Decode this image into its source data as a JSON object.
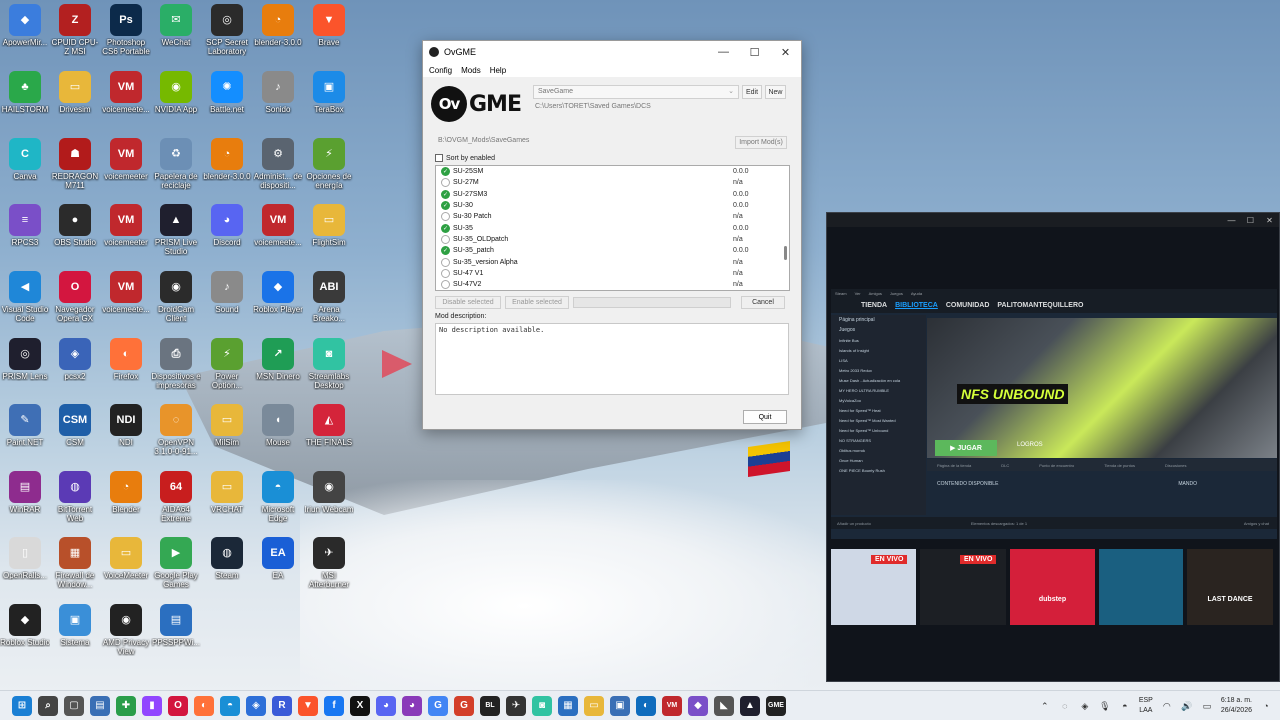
{
  "desktop": {
    "icons": [
      {
        "label": "ApowerMir...",
        "glyph": "◆",
        "color": "#3b7ddd"
      },
      {
        "label": "CPUID CPU-Z MSI",
        "glyph": "Z",
        "color": "#b32020"
      },
      {
        "label": "Photoshop CS6 Portable",
        "glyph": "Ps",
        "color": "#0c2a4a"
      },
      {
        "label": "WeChat",
        "glyph": "✉",
        "color": "#2aae67"
      },
      {
        "label": "SCP Secret Laboratory",
        "glyph": "◎",
        "color": "#2b2b2b"
      },
      {
        "label": "blender-3.0.0",
        "glyph": "◔",
        "color": "#e87d0d"
      },
      {
        "label": "Brave",
        "glyph": "▼",
        "color": "#fb542b"
      },
      {
        "label": "HAILSTORM",
        "glyph": "♣",
        "color": "#2aa84a"
      },
      {
        "label": "Drivesim",
        "glyph": "▭",
        "color": "#e8b73a"
      },
      {
        "label": "voicemeete...",
        "glyph": "VM",
        "color": "#c0282d"
      },
      {
        "label": "NVIDIA App",
        "glyph": "◉",
        "color": "#76b900"
      },
      {
        "label": "Battle.net",
        "glyph": "✺",
        "color": "#148eff"
      },
      {
        "label": "Sonido",
        "glyph": "♪",
        "color": "#8a8a8a"
      },
      {
        "label": "TeraBox",
        "glyph": "▣",
        "color": "#1c8be8"
      },
      {
        "label": "Canva",
        "glyph": "C",
        "color": "#1fb6c6"
      },
      {
        "label": "REDRAGON M711",
        "glyph": "☗",
        "color": "#b21b1b"
      },
      {
        "label": "voicemeeter",
        "glyph": "VM",
        "color": "#c0282d"
      },
      {
        "label": "Papelera de reciclaje",
        "glyph": "♻",
        "color": "#6c8fb5"
      },
      {
        "label": "blender-3.0.0",
        "glyph": "◔",
        "color": "#e87d0d"
      },
      {
        "label": "Administ... de dispositi...",
        "glyph": "⚙",
        "color": "#5a6470"
      },
      {
        "label": "Opciones de energía",
        "glyph": "⚡",
        "color": "#5aa030"
      },
      {
        "label": "RPCS3",
        "glyph": "≡",
        "color": "#7a4fc8"
      },
      {
        "label": "OBS Studio",
        "glyph": "●",
        "color": "#2b2b2b"
      },
      {
        "label": "voicemeeter",
        "glyph": "VM",
        "color": "#c0282d"
      },
      {
        "label": "PRISM Live Studio",
        "glyph": "▲",
        "color": "#1f1f2e"
      },
      {
        "label": "Discord",
        "glyph": "◕",
        "color": "#5865f2"
      },
      {
        "label": "voicemeete...",
        "glyph": "VM",
        "color": "#c0282d"
      },
      {
        "label": "FlightSim",
        "glyph": "▭",
        "color": "#e8b73a"
      },
      {
        "label": "Visual Studio Code",
        "glyph": "◀",
        "color": "#1f87d8"
      },
      {
        "label": "Navegador Opera GX",
        "glyph": "O",
        "color": "#d3163f"
      },
      {
        "label": "voicemeete...",
        "glyph": "VM",
        "color": "#c0282d"
      },
      {
        "label": "DroidCam Client",
        "glyph": "◉",
        "color": "#2b2b2b"
      },
      {
        "label": "Sound",
        "glyph": "♪",
        "color": "#8a8a8a"
      },
      {
        "label": "Roblox Player",
        "glyph": "◆",
        "color": "#1a73e8"
      },
      {
        "label": "Arena Breako...",
        "glyph": "ABI",
        "color": "#3a3a3a"
      },
      {
        "label": "PRISM Lens",
        "glyph": "◎",
        "color": "#1f1f2e"
      },
      {
        "label": "pcsx2",
        "glyph": "◈",
        "color": "#3a64b8"
      },
      {
        "label": "Firefox",
        "glyph": "◐",
        "color": "#ff7139"
      },
      {
        "label": "Dispositivos e impresoras",
        "glyph": "⎙",
        "color": "#6a7480"
      },
      {
        "label": "Power Option...",
        "glyph": "⚡",
        "color": "#5aa030"
      },
      {
        "label": "MSN Dinero",
        "glyph": "↗",
        "color": "#1f9d55"
      },
      {
        "label": "Streamlabs Desktop",
        "glyph": "◙",
        "color": "#31c3a2"
      },
      {
        "label": "Paint.NET",
        "glyph": "✎",
        "color": "#3f6fb5"
      },
      {
        "label": "CSM",
        "glyph": "CSM",
        "color": "#1f5fa8"
      },
      {
        "label": "NDI",
        "glyph": "NDI",
        "color": "#222222"
      },
      {
        "label": "OpenVPN 3.1.0-0-91...",
        "glyph": "◌",
        "color": "#e8942a"
      },
      {
        "label": "MilSim",
        "glyph": "▭",
        "color": "#e8b73a"
      },
      {
        "label": "Mouse",
        "glyph": "◖",
        "color": "#7a8a9a"
      },
      {
        "label": "THE FINALS",
        "glyph": "◭",
        "color": "#d4243a"
      },
      {
        "label": "WinRAR",
        "glyph": "▤",
        "color": "#8e2c8e"
      },
      {
        "label": "BitTorrent Web",
        "glyph": "◍",
        "color": "#5b3ab5"
      },
      {
        "label": "Blender",
        "glyph": "◔",
        "color": "#e87d0d"
      },
      {
        "label": "AIDA64 Extreme",
        "glyph": "64",
        "color": "#c81e1e"
      },
      {
        "label": "VRCHAT",
        "glyph": "▭",
        "color": "#e8b73a"
      },
      {
        "label": "Microsoft Edge",
        "glyph": "◓",
        "color": "#1a8fd6"
      },
      {
        "label": "Iriun Webcam",
        "glyph": "◉",
        "color": "#444444"
      },
      {
        "label": "OpenRalls...",
        "glyph": "▯",
        "color": "#d9d9d9"
      },
      {
        "label": "Firewall de Window...",
        "glyph": "▦",
        "color": "#b8502a"
      },
      {
        "label": "VoiceMeeter",
        "glyph": "▭",
        "color": "#e8b73a"
      },
      {
        "label": "Google Play Games",
        "glyph": "▶",
        "color": "#34a853"
      },
      {
        "label": "Steam",
        "glyph": "◍",
        "color": "#1b2838"
      },
      {
        "label": "EA",
        "glyph": "EA",
        "color": "#1a5fd6"
      },
      {
        "label": "MSI Afterburner",
        "glyph": "✈",
        "color": "#2a2a2a"
      },
      {
        "label": "Roblox Studio",
        "glyph": "◆",
        "color": "#222222"
      },
      {
        "label": "Sistema",
        "glyph": "▣",
        "color": "#3a8fd8"
      },
      {
        "label": "AMD Privacy View",
        "glyph": "◉",
        "color": "#222222"
      },
      {
        "label": "PPSSPPWi...",
        "glyph": "▤",
        "color": "#2b6fc0"
      }
    ]
  },
  "ovgme": {
    "title": "OvGME",
    "menu": [
      "Config",
      "Mods",
      "Help"
    ],
    "logo_text": "GME",
    "logo_circle": "Ov",
    "config_select": "SaveGame",
    "edit_label": "Edit",
    "new_label": "New",
    "config_path": "C:\\Users\\TORET\\Saved Games\\DCS",
    "mods_path": "B:\\OVGM_Mods\\SaveGames",
    "import_label": "Import Mod(s)",
    "sort_label": "Sort by enabled",
    "mods": [
      {
        "name": "SU-25SM",
        "version": "0.0.0",
        "enabled": true
      },
      {
        "name": "SU-27M",
        "version": "n/a",
        "enabled": false
      },
      {
        "name": "SU-27SM3",
        "version": "0.0.0",
        "enabled": true
      },
      {
        "name": "SU-30",
        "version": "0.0.0",
        "enabled": true
      },
      {
        "name": "Su-30 Patch",
        "version": "n/a",
        "enabled": false
      },
      {
        "name": "SU-35",
        "version": "0.0.0",
        "enabled": true
      },
      {
        "name": "SU-35_OLDpatch",
        "version": "n/a",
        "enabled": false
      },
      {
        "name": "SU-35_patch",
        "version": "0.0.0",
        "enabled": true
      },
      {
        "name": "Su-35_version Alpha",
        "version": "n/a",
        "enabled": false
      },
      {
        "name": "SU-47 V1",
        "version": "n/a",
        "enabled": false
      },
      {
        "name": "SU-47V2",
        "version": "n/a",
        "enabled": false
      }
    ],
    "disable_label": "Disable selected",
    "enable_label": "Enable selected",
    "cancel_label": "Cancel",
    "desc_label": "Mod description:",
    "desc_text": "No description available.",
    "quit_label": "Quit"
  },
  "steam": {
    "top_menu": [
      "Steam",
      "Ver",
      "Amigos",
      "Juegos",
      "Ayuda"
    ],
    "nav": [
      "TIENDA",
      "BIBLIOTECA",
      "COMUNIDAD",
      "PALITOMANTEQUILLERO"
    ],
    "nav_active": 1,
    "sidebar_header": "Página principal",
    "sidebar_filter": "Juegos",
    "games": [
      "Infinite Bus",
      "Islands of Insight",
      "LISA",
      "Metro 2033 Redux",
      "Muse Dash - Actualización en cola",
      "MY HERO ULTRA RUMBLE",
      "MyVolcaZoo",
      "Need for Speed™ Heat",
      "Need for Speed™ Most Wanted",
      "Need for Speed™ Unbound",
      "NO STRANGERS",
      "Oblitus morrok",
      "Once Human",
      "ONE PIECE Bounty Rush"
    ],
    "hero_logo": "NFS UNBOUND",
    "play_label": "JUGAR",
    "logros_label": "LOGROS",
    "subnav": [
      "Página de la tienda",
      "DLC",
      "Punto de encuentro",
      "Tienda de puntos",
      "Discusiones"
    ],
    "content_heading": "CONTENIDO DISPONIBLE",
    "mando_label": "MANDO",
    "bottom_left": "Añadir un producto",
    "bottom_mid": "Elementos descargados: 1 de 1",
    "bottom_right": "Amigos y chat"
  },
  "thumbs": [
    {
      "badge": "EN VIVO",
      "label": "",
      "bg": "#cfd8e6"
    },
    {
      "badge": "EN VIVO",
      "label": "",
      "bg": "#1c1f24"
    },
    {
      "badge": "",
      "label": "dubstep",
      "bg": "#d41f3a"
    },
    {
      "badge": "",
      "label": "",
      "bg": "#1a5f80"
    },
    {
      "badge": "",
      "label": "LAST DANCE",
      "bg": "#2a2420"
    }
  ],
  "taskbar": {
    "apps": [
      {
        "glyph": "⊞",
        "color": "#1a7fd4"
      },
      {
        "glyph": "⌕",
        "color": "#444444"
      },
      {
        "glyph": "▢",
        "color": "#555555"
      },
      {
        "glyph": "▤",
        "color": "#3a6fb5"
      },
      {
        "glyph": "✚",
        "color": "#2a9d4a"
      },
      {
        "glyph": "▮",
        "color": "#9146ff"
      },
      {
        "glyph": "O",
        "color": "#d3163f"
      },
      {
        "glyph": "◐",
        "color": "#ff7139"
      },
      {
        "glyph": "◓",
        "color": "#1a8fd6"
      },
      {
        "glyph": "◈",
        "color": "#2d6fd8"
      },
      {
        "glyph": "R",
        "color": "#3a5bd8"
      },
      {
        "glyph": "▼",
        "color": "#fb542b"
      },
      {
        "glyph": "f",
        "color": "#1877f2"
      },
      {
        "glyph": "X",
        "color": "#111111"
      },
      {
        "glyph": "◕",
        "color": "#5865f2"
      },
      {
        "glyph": "◕",
        "color": "#8a3ab9"
      },
      {
        "glyph": "G",
        "color": "#4285f4"
      },
      {
        "glyph": "G",
        "color": "#d33f2a"
      },
      {
        "glyph": "BL",
        "color": "#222222"
      },
      {
        "glyph": "✈",
        "color": "#333333"
      },
      {
        "glyph": "◙",
        "color": "#31c3a2"
      },
      {
        "glyph": "▦",
        "color": "#2b6fc0"
      },
      {
        "glyph": "▭",
        "color": "#e8b73a"
      },
      {
        "glyph": "▣",
        "color": "#3a6fb5"
      },
      {
        "glyph": "◐",
        "color": "#0f6cbd"
      },
      {
        "glyph": "VM",
        "color": "#c0282d"
      },
      {
        "glyph": "◆",
        "color": "#7a4fc8"
      },
      {
        "glyph": "◣",
        "color": "#555555"
      },
      {
        "glyph": "▲",
        "color": "#1f1f2e"
      },
      {
        "glyph": "GME",
        "color": "#222222"
      }
    ],
    "lang_top": "ESP",
    "lang_bottom": "LAA",
    "time": "6:18 a. m.",
    "date": "26/4/2026"
  }
}
